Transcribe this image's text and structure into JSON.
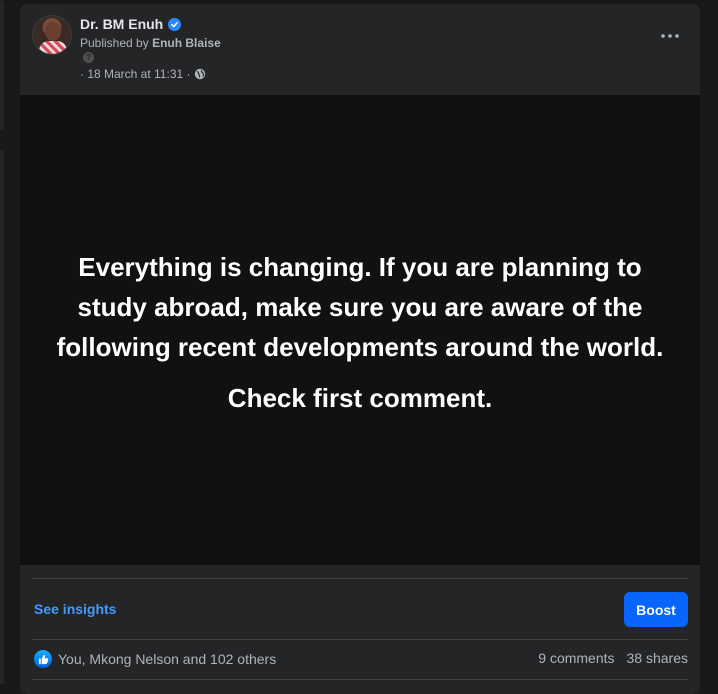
{
  "post": {
    "author_name": "Dr. BM Enuh",
    "published_by_prefix": "Published by",
    "published_by_name": "Enuh Blaise",
    "help_glyph": "?",
    "timestamp": "· 18 March at 11:31 ·",
    "privacy_icon": "globe-icon",
    "more_icon": "ellipsis-icon"
  },
  "content": {
    "text": "Everything is changing. If you are planning to study abroad, make sure you are aware of the following recent developments around the world.",
    "cta": "Check first comment.",
    "background_color": "#111112"
  },
  "actions": {
    "insights_label": "See insights",
    "boost_label": "Boost",
    "accent_color": "#0866ff"
  },
  "engagement": {
    "reaction_icon": "like-icon",
    "reactions_text": "You, Mkong Nelson and 102 others",
    "comments_text": "9 comments",
    "shares_text": "38 shares"
  }
}
